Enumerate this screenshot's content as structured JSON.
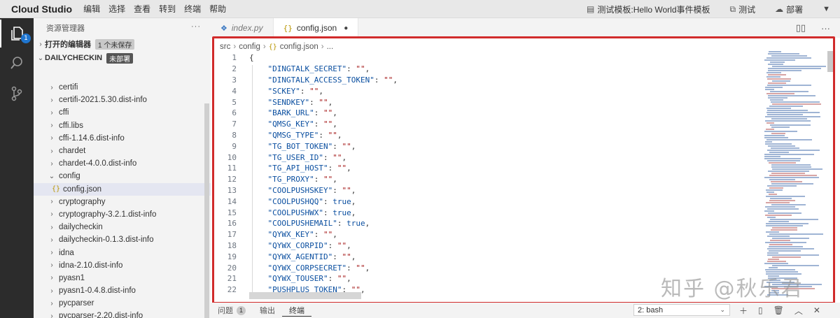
{
  "titlebar": {
    "brand": "Cloud Studio",
    "menu": [
      "编辑",
      "选择",
      "查看",
      "转到",
      "终端",
      "帮助"
    ],
    "template": "测试模板:Hello World事件模板",
    "test_label": "测试",
    "deploy_label": "部署"
  },
  "activity": {
    "explorer_badge": "1"
  },
  "sidebar": {
    "title": "资源管理器",
    "open_editors": "打开的编辑器",
    "unsaved_tag": "1 个未保存",
    "project": "DAILYCHECKIN",
    "deploy_tag": "未部署",
    "items": [
      {
        "label": "certifi",
        "type": "folder"
      },
      {
        "label": "certifi-2021.5.30.dist-info",
        "type": "folder"
      },
      {
        "label": "cffi",
        "type": "folder"
      },
      {
        "label": "cffi.libs",
        "type": "folder"
      },
      {
        "label": "cffi-1.14.6.dist-info",
        "type": "folder"
      },
      {
        "label": "chardet",
        "type": "folder"
      },
      {
        "label": "chardet-4.0.0.dist-info",
        "type": "folder"
      },
      {
        "label": "config",
        "type": "open-folder"
      },
      {
        "label": "config.json",
        "type": "file"
      },
      {
        "label": "cryptography",
        "type": "folder"
      },
      {
        "label": "cryptography-3.2.1.dist-info",
        "type": "folder"
      },
      {
        "label": "dailycheckin",
        "type": "folder"
      },
      {
        "label": "dailycheckin-0.1.3.dist-info",
        "type": "folder"
      },
      {
        "label": "idna",
        "type": "folder"
      },
      {
        "label": "idna-2.10.dist-info",
        "type": "folder"
      },
      {
        "label": "pyasn1",
        "type": "folder"
      },
      {
        "label": "pyasn1-0.4.8.dist-info",
        "type": "folder"
      },
      {
        "label": "pycparser",
        "type": "folder"
      },
      {
        "label": "pycparser-2.20.dist-info",
        "type": "folder"
      }
    ]
  },
  "tabs": [
    {
      "label": "index.py",
      "active": false
    },
    {
      "label": "config.json",
      "active": true,
      "dirty": true
    }
  ],
  "breadcrumb": [
    "src",
    "config",
    "config.json",
    "..."
  ],
  "code": [
    {
      "n": "1",
      "key": "",
      "val": "",
      "text": "{"
    },
    {
      "n": "2",
      "key": "\"DINGTALK_SECRET\"",
      "val": "\"\"",
      "kind": "str"
    },
    {
      "n": "3",
      "key": "\"DINGTALK_ACCESS_TOKEN\"",
      "val": "\"\"",
      "kind": "str"
    },
    {
      "n": "4",
      "key": "\"SCKEY\"",
      "val": "\"\"",
      "kind": "str"
    },
    {
      "n": "5",
      "key": "\"SENDKEY\"",
      "val": "\"\"",
      "kind": "str"
    },
    {
      "n": "6",
      "key": "\"BARK_URL\"",
      "val": "\"\"",
      "kind": "str"
    },
    {
      "n": "7",
      "key": "\"QMSG_KEY\"",
      "val": "\"\"",
      "kind": "str"
    },
    {
      "n": "8",
      "key": "\"QMSG_TYPE\"",
      "val": "\"\"",
      "kind": "str"
    },
    {
      "n": "9",
      "key": "\"TG_BOT_TOKEN\"",
      "val": "\"\"",
      "kind": "str"
    },
    {
      "n": "10",
      "key": "\"TG_USER_ID\"",
      "val": "\"\"",
      "kind": "str"
    },
    {
      "n": "11",
      "key": "\"TG_API_HOST\"",
      "val": "\"\"",
      "kind": "str"
    },
    {
      "n": "12",
      "key": "\"TG_PROXY\"",
      "val": "\"\"",
      "kind": "str"
    },
    {
      "n": "13",
      "key": "\"COOLPUSHSKEY\"",
      "val": "\"\"",
      "kind": "str"
    },
    {
      "n": "14",
      "key": "\"COOLPUSHQQ\"",
      "val": "true",
      "kind": "lit"
    },
    {
      "n": "15",
      "key": "\"COOLPUSHWX\"",
      "val": "true",
      "kind": "lit"
    },
    {
      "n": "16",
      "key": "\"COOLPUSHEMAIL\"",
      "val": "true",
      "kind": "lit"
    },
    {
      "n": "17",
      "key": "\"QYWX_KEY\"",
      "val": "\"\"",
      "kind": "str"
    },
    {
      "n": "18",
      "key": "\"QYWX_CORPID\"",
      "val": "\"\"",
      "kind": "str"
    },
    {
      "n": "19",
      "key": "\"QYWX_AGENTID\"",
      "val": "\"\"",
      "kind": "str"
    },
    {
      "n": "20",
      "key": "\"QYWX_CORPSECRET\"",
      "val": "\"\"",
      "kind": "str"
    },
    {
      "n": "21",
      "key": "\"QYWX_TOUSER\"",
      "val": "\"\"",
      "kind": "str"
    },
    {
      "n": "22",
      "key": "\"PUSHPLUS_TOKEN\"",
      "val": "\"\"",
      "kind": "str"
    }
  ],
  "panel": {
    "tabs": [
      "问题",
      "输出",
      "终端"
    ],
    "problems_count": "1",
    "terminal": "2: bash"
  },
  "watermark": "知乎 @秋乐君"
}
